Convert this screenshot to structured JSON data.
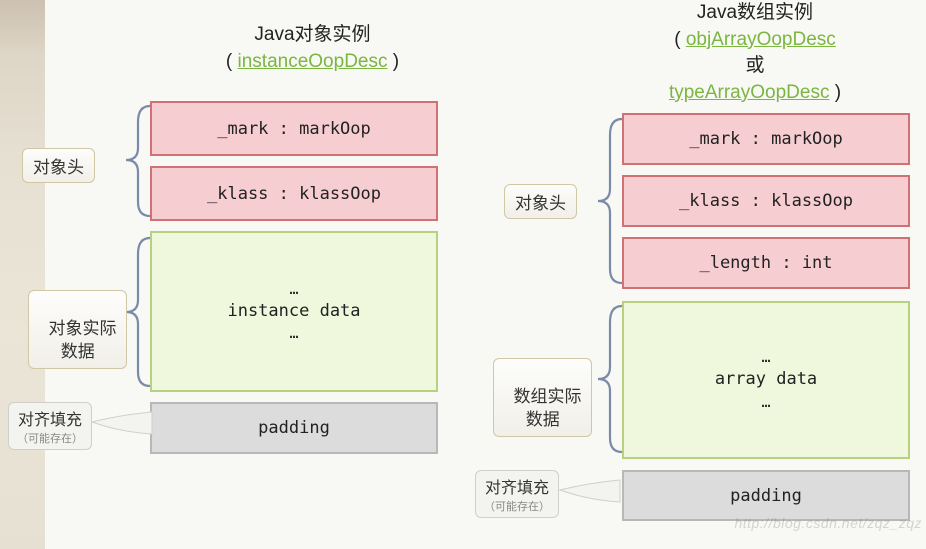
{
  "left": {
    "title": "Java对象实例",
    "link": "instanceOopDesc",
    "rows": {
      "mark": "_mark : markOop",
      "klass": "_klass : klassOop",
      "data_mid": "instance data",
      "padding": "padding"
    },
    "labels": {
      "header": "对象头",
      "data": "对象实际\n数据",
      "padding_t1": "对齐填充",
      "padding_t2": "（可能存在）"
    }
  },
  "right": {
    "title": "Java数组实例",
    "link1": "objArrayOopDesc",
    "or": "或",
    "link2": "typeArrayOopDesc",
    "rows": {
      "mark": "_mark : markOop",
      "klass": "_klass : klassOop",
      "length": "_length : int",
      "data_mid": "array data",
      "padding": "padding"
    },
    "labels": {
      "header": "对象头",
      "data": "数组实际\n数据",
      "padding_t1": "对齐填充",
      "padding_t2": "（可能存在）"
    }
  },
  "watermark": "http://blog.csdn.net/zqz_zqz"
}
